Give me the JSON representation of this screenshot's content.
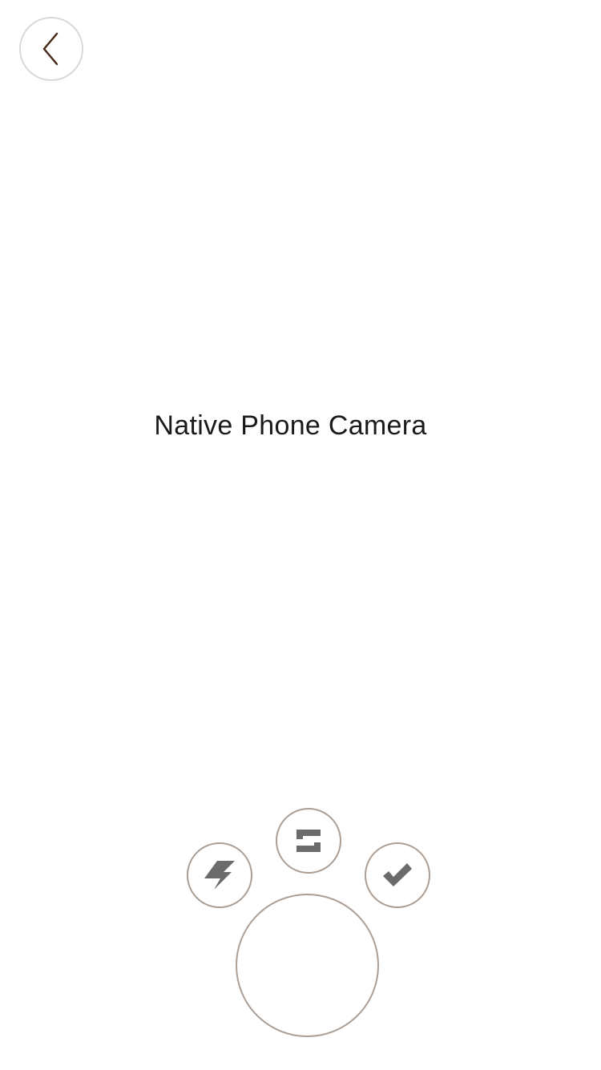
{
  "camera": {
    "placeholder_label": "Native Phone Camera"
  },
  "icons": {
    "back": "chevron-left-icon",
    "flash": "lightning-bolt-icon",
    "switch_camera": "switch-camera-icon",
    "confirm": "checkmark-icon"
  },
  "colors": {
    "background": "#ffffff",
    "back_icon": "#4a2a1a",
    "control_border": "#ab9e95",
    "back_border": "#dcd7d3",
    "control_icon": "#6b6b6b",
    "text": "#1a1a1a"
  }
}
